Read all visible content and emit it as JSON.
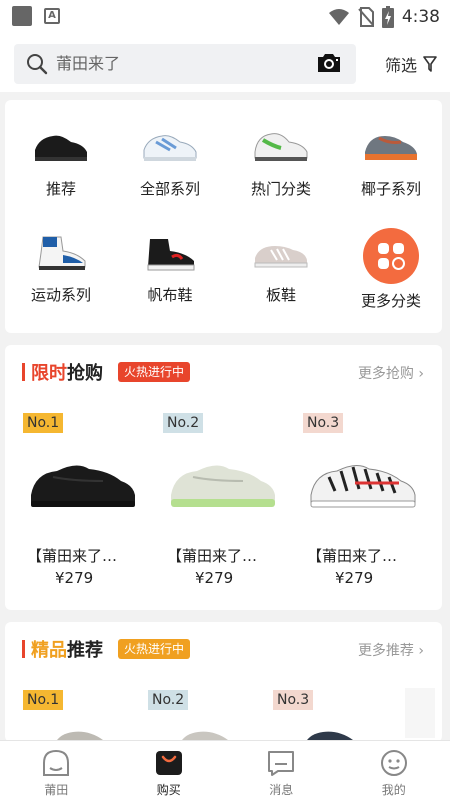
{
  "status_bar": {
    "time": "4:38",
    "badge_letter": "A"
  },
  "search": {
    "placeholder": "莆田来了"
  },
  "filter": {
    "label": "筛选"
  },
  "categories": [
    {
      "label": "推荐",
      "icon": "black-sneaker"
    },
    {
      "label": "全部系列",
      "icon": "white-blue-sneaker"
    },
    {
      "label": "热门分类",
      "icon": "white-green-sneaker"
    },
    {
      "label": "椰子系列",
      "icon": "orange-grey-sneaker"
    },
    {
      "label": "运动系列",
      "icon": "blue-high-top-sneaker"
    },
    {
      "label": "帆布鞋",
      "icon": "black-canvas-shoe"
    },
    {
      "label": "板鞋",
      "icon": "grey-skate-shoe"
    },
    {
      "label": "更多分类",
      "icon": "grid-icon"
    }
  ],
  "flash_sale": {
    "title_highlight": "限时",
    "title_rest": "抢购",
    "badge": "火热进行中",
    "more": "更多抢购",
    "products": [
      {
        "rank": "No.1",
        "name": "【莆田来了…",
        "price": "¥279"
      },
      {
        "rank": "No.2",
        "name": "【莆田来了…",
        "price": "¥279"
      },
      {
        "rank": "No.3",
        "name": "【莆田来了…",
        "price": "¥279"
      }
    ]
  },
  "featured": {
    "title_highlight": "精品",
    "title_rest": "推荐",
    "badge": "火热进行中",
    "more": "更多推荐",
    "products": [
      {
        "rank": "No.1"
      },
      {
        "rank": "No.2"
      },
      {
        "rank": "No.3"
      }
    ]
  },
  "nav": [
    {
      "label": "莆田",
      "icon": "face-icon"
    },
    {
      "label": "购买",
      "icon": "shopping-bag-icon"
    },
    {
      "label": "消息",
      "icon": "message-icon"
    },
    {
      "label": "我的",
      "icon": "smile-icon"
    }
  ],
  "colors": {
    "accent": "#f36b3f",
    "red": "#e8452c",
    "gold": "#f0a020",
    "rank1": "#f5b731",
    "rank2": "#cfe0e6",
    "rank3": "#f3d8cf"
  }
}
